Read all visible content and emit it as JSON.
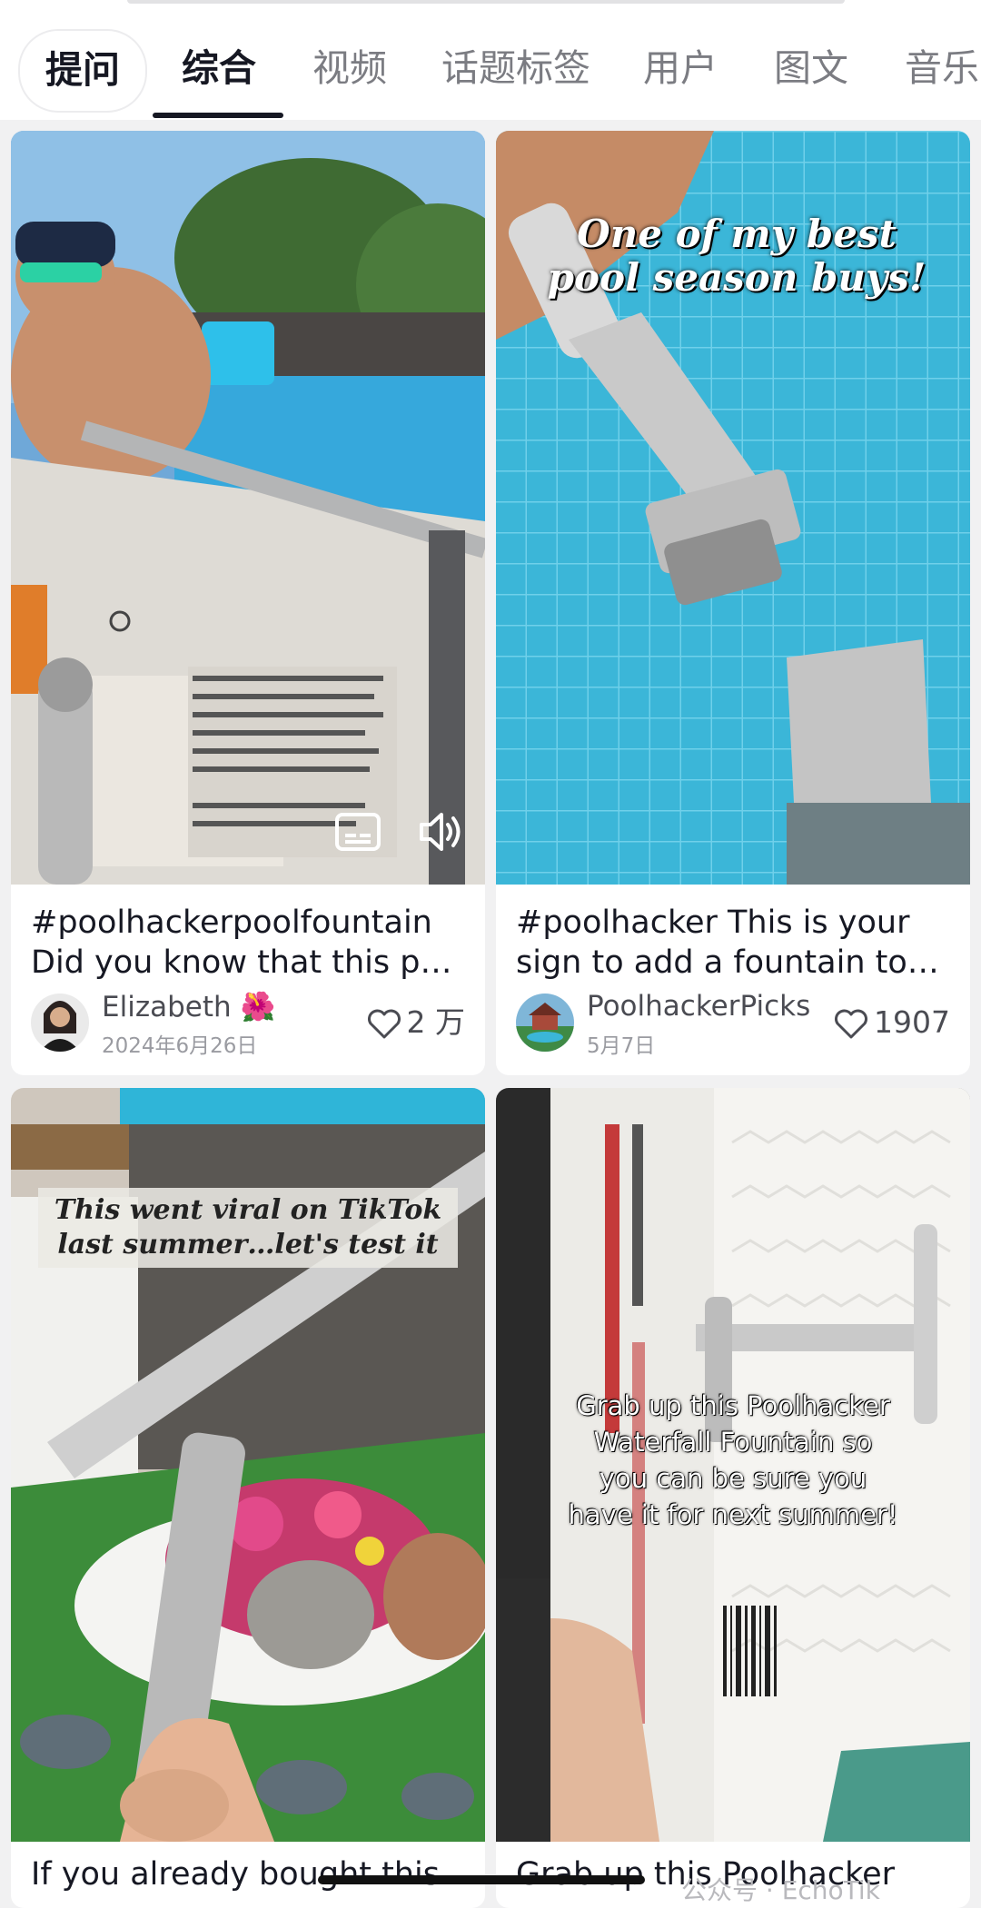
{
  "tabs": {
    "ask": "提问",
    "items": [
      "综合",
      "视频",
      "话题标签",
      "用户",
      "图文",
      "音乐"
    ],
    "active_index": 0
  },
  "cards": [
    {
      "overlay_text": "",
      "title_line1": "#poolhackerpoolfountain",
      "title_line2": "Did you know that this p…",
      "author": "Elizabeth 🌺",
      "date": "2024年6月26日",
      "likes": "2 万"
    },
    {
      "overlay_line1": "One of my best",
      "overlay_line2": "pool season buys!",
      "title_line1": "#poolhacker This is your",
      "title_line2": "sign to add a fountain to…",
      "author": "PoolhackerPicks",
      "date": "5月7日",
      "likes": "1907"
    },
    {
      "overlay_line1": "This went viral on TikTok",
      "overlay_line2": "last summer…let's test it",
      "title_line1": "If you already bought this"
    },
    {
      "overlay_line1": "Grab up this Poolhacker",
      "overlay_line2": "Waterfall Fountain so",
      "overlay_line3": "you can be sure you",
      "overlay_line4": "have it for next summer!",
      "title_line1": "Grab up this Poolhacker"
    }
  ],
  "watermark": "公众号 · EchoTik",
  "colors": {
    "pool": "#3bb6d8",
    "text": "#161823",
    "muted": "#7b7c82"
  }
}
